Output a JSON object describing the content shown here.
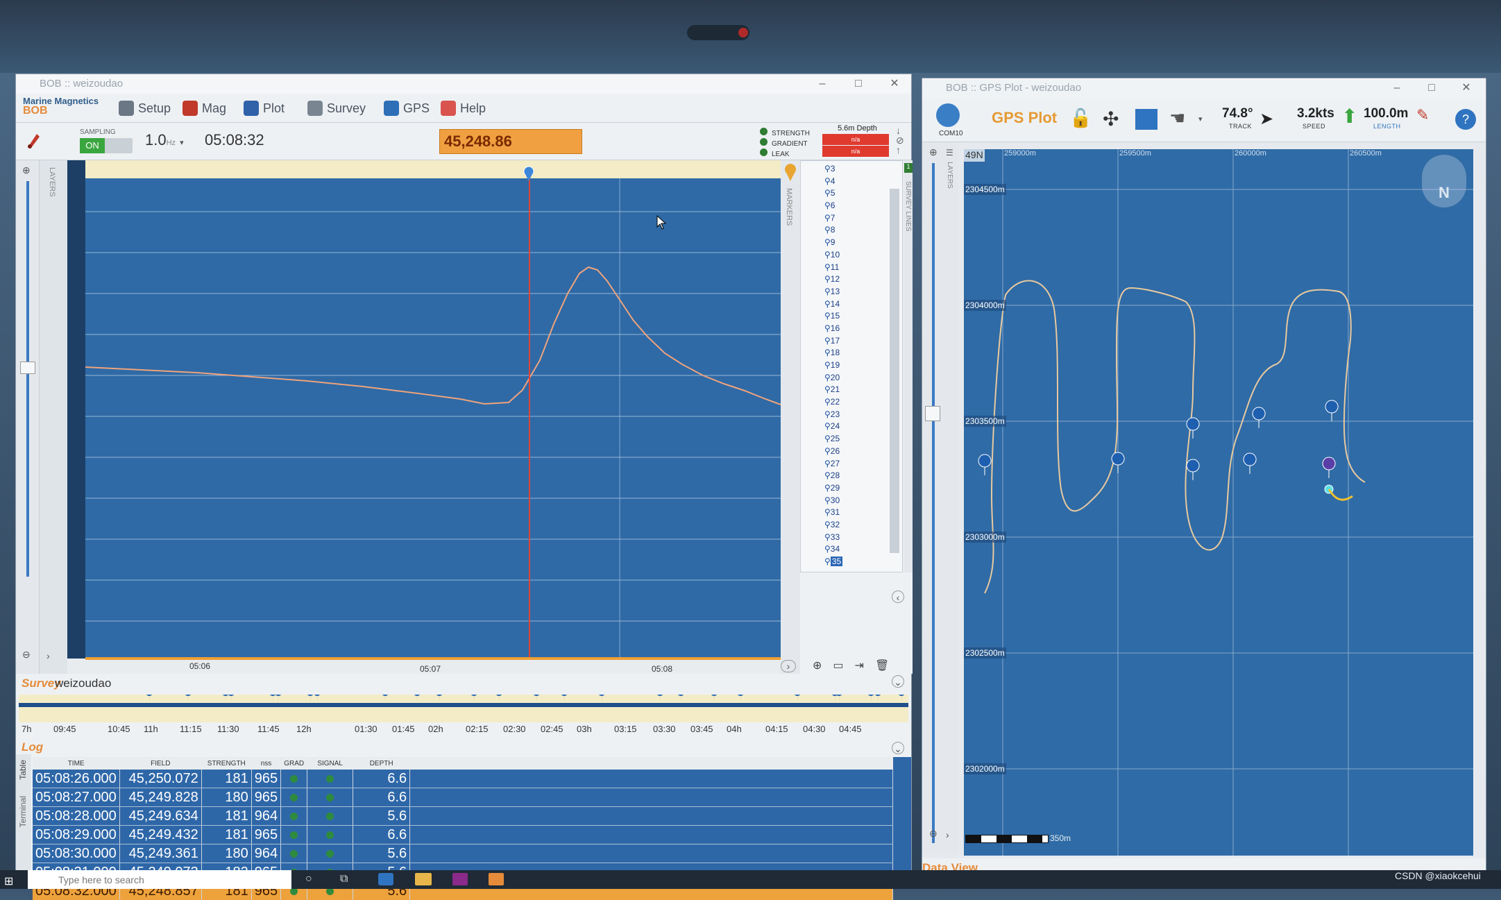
{
  "left_window": {
    "title": "BOB :: weizoudao",
    "brand": {
      "line1": "Marine Magnetics",
      "line2": "BOB"
    },
    "menu": [
      {
        "label": "Setup",
        "icon": "wrench-icon",
        "color": "#6b7785"
      },
      {
        "label": "Mag",
        "icon": "magnetometer-icon",
        "color": "#c0392b"
      },
      {
        "label": "Plot",
        "icon": "plot-icon",
        "color": "#2f62a8"
      },
      {
        "label": "Survey",
        "icon": "survey-icon",
        "color": "#7a8592"
      },
      {
        "label": "GPS",
        "icon": "globe-icon",
        "color": "#2e6fb8"
      },
      {
        "label": "Help",
        "icon": "lifebuoy-icon",
        "color": "#d9534f"
      }
    ],
    "status": {
      "sampling_label": "SAMPLING",
      "sampling_state": "ON",
      "rate": "1.0",
      "rate_unit": "Hz",
      "time": "05:08:32",
      "field_value": "45,248.86",
      "legend": [
        "STRENGTH",
        "GRADIENT",
        "LEAK"
      ],
      "depth_label": "5.6m Depth",
      "depth_boxes": [
        "n/a",
        "n/a"
      ]
    },
    "plot": {
      "x_ticks": [
        "05:06",
        "05:07",
        "05:08"
      ],
      "side_label_markers": "MARKERS",
      "side_label_survey": "SURVEY LINES",
      "side_label_layers": "LAYERS"
    },
    "markers": [
      "3",
      "4",
      "5",
      "6",
      "7",
      "8",
      "9",
      "10",
      "11",
      "12",
      "13",
      "14",
      "15",
      "16",
      "17",
      "18",
      "19",
      "20",
      "21",
      "22",
      "23",
      "24",
      "25",
      "26",
      "27",
      "28",
      "29",
      "30",
      "31",
      "32",
      "33",
      "34",
      "35"
    ],
    "selected_marker": "35",
    "survey": {
      "label": "Survey",
      "name": "weizoudao",
      "timeline_ticks": [
        "7h",
        "09:45",
        "10:45",
        "11h",
        "11:15",
        "11:30",
        "11:45",
        "12h",
        "01:30",
        "01:45",
        "02h",
        "02:15",
        "02:30",
        "02:45",
        "03h",
        "03:15",
        "03:30",
        "03:45",
        "04h",
        "04:15",
        "04:30",
        "04:45"
      ]
    },
    "log": {
      "label": "Log",
      "tabs": [
        "Table",
        "Terminal"
      ],
      "headers": [
        "TIME",
        "FIELD",
        "STRENGTH",
        "nss",
        "GRAD",
        "SIGNAL",
        "DEPTH"
      ],
      "rows": [
        {
          "time": "05:08:26.000",
          "field": "45,250.072",
          "strength": "181",
          "nss": "965",
          "depth": "6.6"
        },
        {
          "time": "05:08:27.000",
          "field": "45,249.828",
          "strength": "180",
          "nss": "965",
          "depth": "6.6"
        },
        {
          "time": "05:08:28.000",
          "field": "45,249.634",
          "strength": "181",
          "nss": "964",
          "depth": "5.6"
        },
        {
          "time": "05:08:29.000",
          "field": "45,249.432",
          "strength": "181",
          "nss": "965",
          "depth": "6.6"
        },
        {
          "time": "05:08:30.000",
          "field": "45,249.361",
          "strength": "180",
          "nss": "964",
          "depth": "5.6"
        },
        {
          "time": "05:08:31.000",
          "field": "45,249.073",
          "strength": "182",
          "nss": "965",
          "depth": "5.6"
        },
        {
          "time": "05:08:32.000",
          "field": "45,248.857",
          "strength": "181",
          "nss": "965",
          "depth": "5.6"
        }
      ]
    }
  },
  "right_window": {
    "title": "BOB :: GPS Plot - weizoudao",
    "com_label": "COM10",
    "gps_title": "GPS Plot",
    "track": {
      "value": "74.8°",
      "label": "TRACK"
    },
    "speed": {
      "value": "3.2kts",
      "label": "SPEED"
    },
    "distance": {
      "value": "100.0m",
      "label": "LENGTH"
    },
    "zone": "49N",
    "y_labels": [
      "2304500m",
      "2304000m",
      "2303500m",
      "2303000m",
      "2302500m",
      "2302000m"
    ],
    "x_labels": [
      "259000m",
      "259500m",
      "260000m",
      "260500m"
    ],
    "compass_label": "N",
    "scale_label": "350m",
    "layers_label": "LAYERS",
    "data_view_label": "Data View"
  },
  "taskbar": {
    "search_placeholder": "Type here to search"
  },
  "watermark": "CSDN @xiaokcehui"
}
